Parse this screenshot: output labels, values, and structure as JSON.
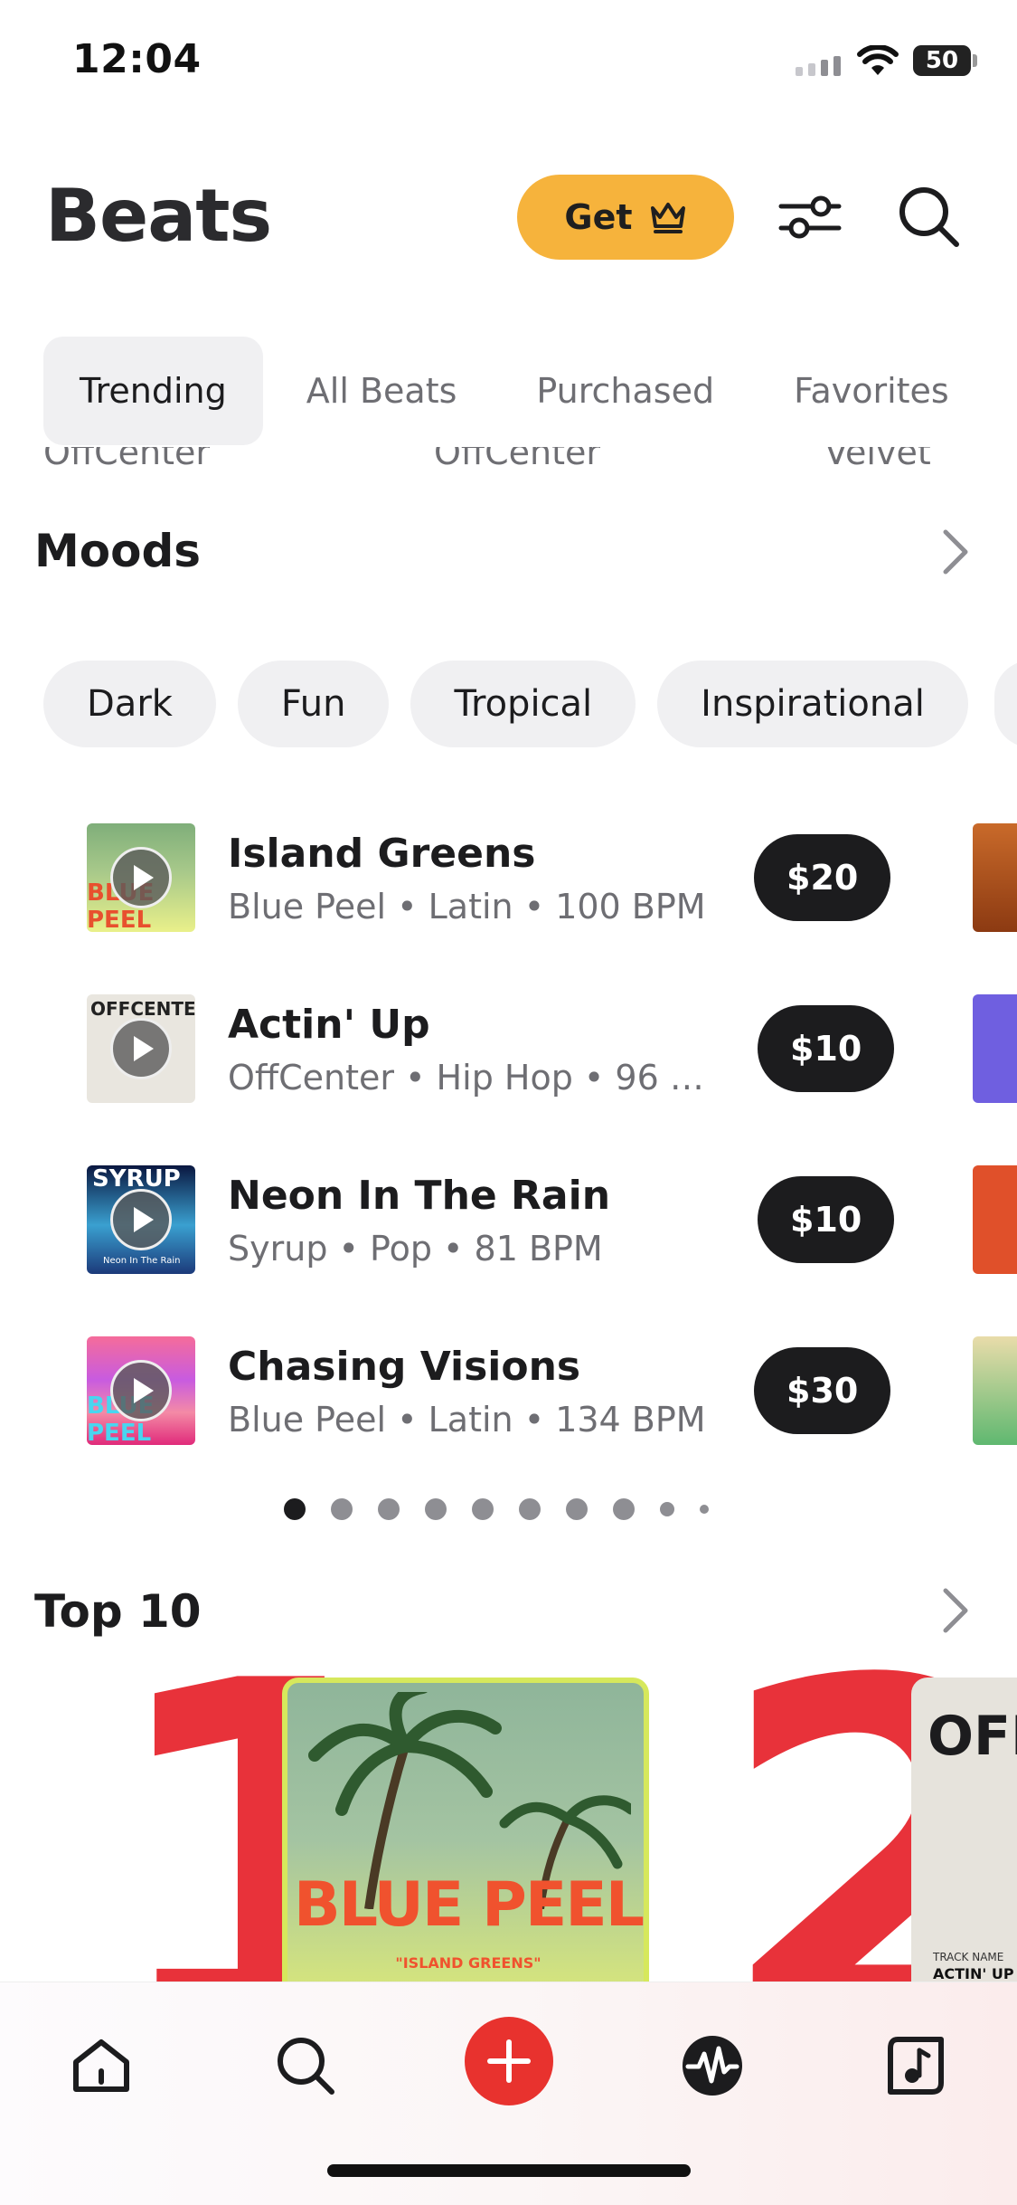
{
  "status": {
    "time": "12:04",
    "battery": "50"
  },
  "header": {
    "title": "Beats",
    "get_label": "Get"
  },
  "tabs": [
    {
      "label": "Trending",
      "active": true
    },
    {
      "label": "All Beats"
    },
    {
      "label": "Purchased"
    },
    {
      "label": "Favorites"
    }
  ],
  "peek_artists": [
    "OffCenter",
    "OffCenter",
    "Velvet"
  ],
  "moods": {
    "title": "Moods",
    "chips": [
      "Dark",
      "Fun",
      "Tropical",
      "Inspirational"
    ]
  },
  "tracks": [
    {
      "title": "Island Greens",
      "meta": "Blue Peel • Latin • 100 BPM",
      "price": "$20",
      "cover_text": "BLUE PEEL"
    },
    {
      "title": "Actin' Up",
      "meta": "OffCenter • Hip Hop • 96 B...",
      "price": "$10",
      "cover_text": "OFFCENTER"
    },
    {
      "title": "Neon In The Rain",
      "meta": "Syrup • Pop • 81 BPM",
      "price": "$10",
      "cover_text": "SYRUP",
      "cover_subtext": "Neon In The Rain"
    },
    {
      "title": "Chasing Visions",
      "meta": "Blue Peel • Latin • 134 BPM",
      "price": "$30",
      "cover_text": "BLUE PEEL"
    }
  ],
  "pager": {
    "count": 10,
    "active": 0
  },
  "top10": {
    "title": "Top 10",
    "items": [
      {
        "rank": "1",
        "cover_text": "BLUE PEEL",
        "cover_subtext": "\"ISLAND GREENS\""
      },
      {
        "rank": "2",
        "cover_text": "OFF",
        "cover_subtext": "TRACK NAME",
        "cover_subtext2": "ACTIN' UP"
      }
    ]
  },
  "nav": [
    "home-icon",
    "search-icon",
    "add-icon",
    "waveform-icon",
    "music-note-icon"
  ],
  "colors": {
    "accent": "#f6b33c",
    "brand_red": "#e8322e",
    "dark": "#1c1c1e",
    "chip_bg": "#f0f0f2"
  }
}
